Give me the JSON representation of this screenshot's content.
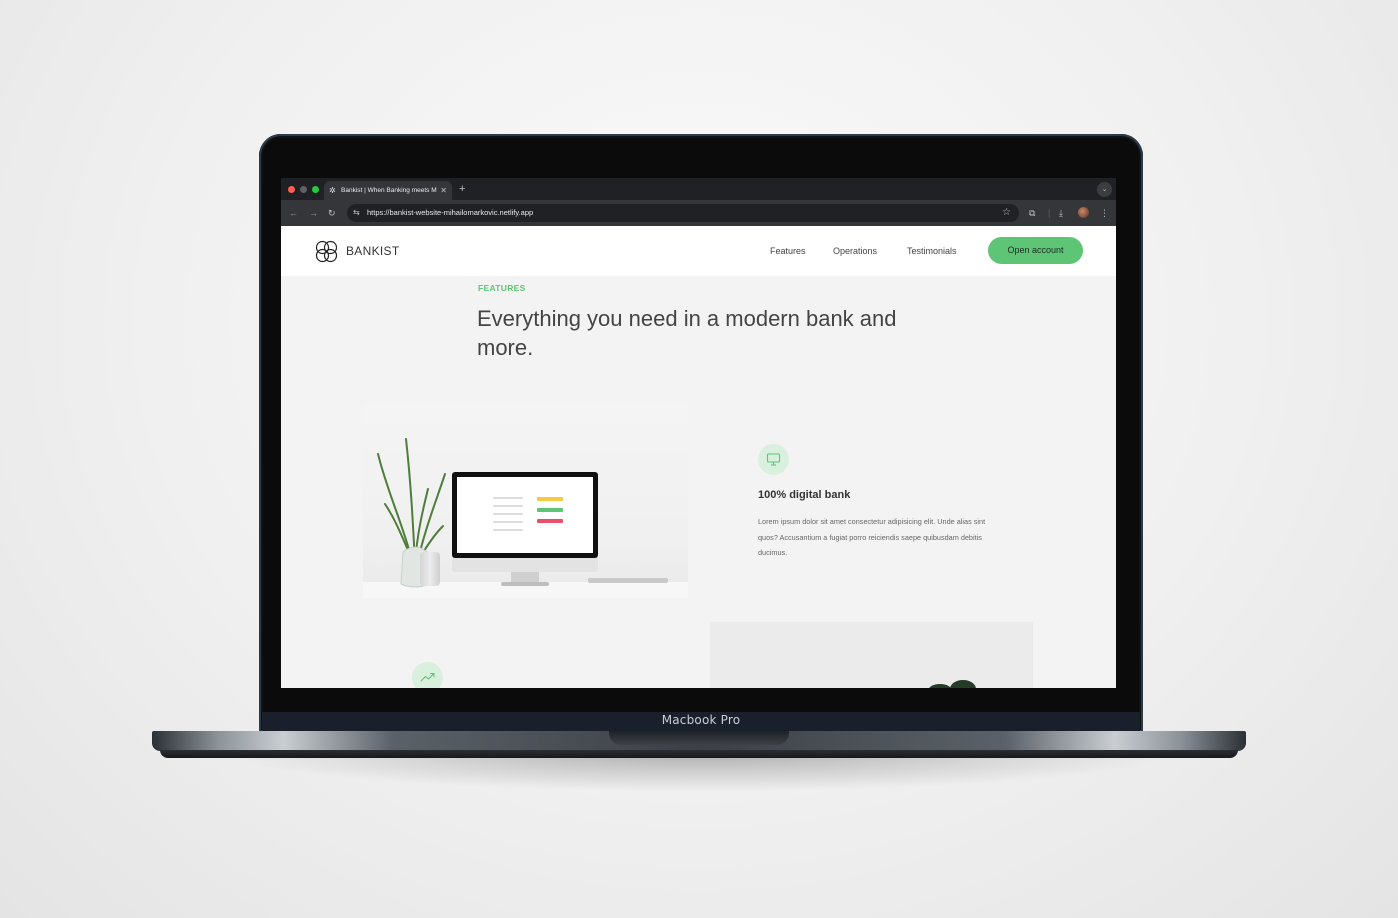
{
  "device": {
    "label": "Macbook Pro"
  },
  "browser": {
    "tab_title": "Bankist | When Banking meets Minimalist",
    "tab_close": "✕",
    "new_tab": "+",
    "url": "https://bankist-website-mihailomarkovic.netlify.app",
    "icons": [
      "back-icon",
      "forward-icon",
      "reload-icon",
      "tune-icon",
      "star-icon",
      "extensions-icon",
      "download-icon",
      "profile-avatar",
      "more-icon",
      "tab-list-icon"
    ]
  },
  "site": {
    "brand": "BANKIST",
    "nav": {
      "features": "Features",
      "operations": "Operations",
      "testimonials": "Testimonials",
      "cta": "Open account"
    },
    "section": {
      "label": "FEATURES",
      "title": "Everything you need in a modern bank and more."
    },
    "feature1": {
      "icon": "monitor-icon",
      "title": "100% digital bank",
      "text": "Lorem ipsum dolor sit amet consectetur adipisicing elit. Unde alias sint quos? Accusantium a fugiat porro reiciendis saepe quibusdam debitis ducimus."
    },
    "feature2": {
      "icon": "trending-up-icon"
    }
  },
  "colors": {
    "accent": "#5ec576",
    "accent_light": "#d9f0de",
    "page_bg": "#f3f3f3",
    "browser_dark": "#202124",
    "browser_toolbar": "#35363a"
  }
}
